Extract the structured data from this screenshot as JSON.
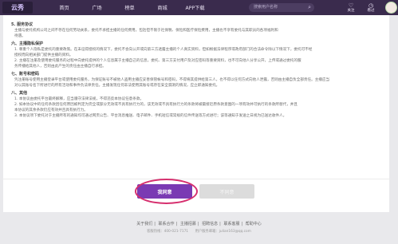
{
  "nav": {
    "logo": "云秀",
    "items": [
      "首页",
      "广场",
      "榜单",
      "商城",
      "APP下载"
    ],
    "search_placeholder": "搜索用户名称",
    "follow_label": "关注",
    "history_label": "看过"
  },
  "content": {
    "lines": [
      "5. 服务协议",
      "主播与委托机构公司之间不存在任何劳动关系，委托不承担主播的任何费用，包括但不限于社保税、保险和医疗保险费用，主播也不享有委托与其职员的各项福利和",
      "待遇。",
      "六、主播隐私保护",
      "1. 尊重个人隐私是委托的重要政策。在未征得授权的情况下，委托不会向公开或向第三方透露主播的个人真实资料，但如根据法律程序或政府部门的合法命令除以下情况下，委托可不经",
      "授权而向相关部门提供主播的资料。",
      "2. 主播在注册及使用委托服务的过程中向委托提供的个人信息属于主播自己的信息，委托、第三方支付用户及对应密码等重要资料，也不可向他人分享公开，上传或通过委托的服",
      "务传播给其他人，否则由此产生的责任由主播自行承担。",
      "七、账号和密码",
      "凭注册账号使用主播登录平台或使用委托服务，为保证账号不被他人盗用主播应妥善保管帐号和密码，不得将其提供给第三人，也不得以任何方式向他人泄露，否则由主播自负全部责任。主播应当",
      "对以其账号名下所进行的所有活动和事件负法律责任。主播发现任何非法使用其账号或存在安全漏洞的情况，应立即通知委托。",
      "八、其他",
      "1. 本协议由委托平台最终解释，应当遵守法律法规，不得违反本协议任意条款。",
      "2. 如本协议中的任何条款因任何原因被判定为完全或部分无效或不具有执行力的，该无效或不具有执行力的条款将被最接近原条款意图的一项有效并可执行的条款所替代，并且",
      "本协议的其余条款仍应有效并且具有执行力。",
      "3. 本协议项下委托对于主播所有的通知均可通过网页公告、平台消息推送、电子邮件、手机短信或常规的信件传送等方式进行；该等通知于发送之日视为已送达收件人。"
    ]
  },
  "buttons": {
    "agree": "我同意",
    "disagree": "不同意"
  },
  "footer": {
    "links": [
      "关于我们",
      "联系合作",
      "主播招募",
      "招聘信息",
      "联系客服",
      "帮助中心"
    ],
    "info": "客服热线：400-021-7171　　用户服务邮箱：julian163@qq.com"
  },
  "colors": {
    "topbar": "#3a2b4d",
    "agree_button": "#7a3ab3",
    "highlight_ring": "#d62f6e"
  }
}
